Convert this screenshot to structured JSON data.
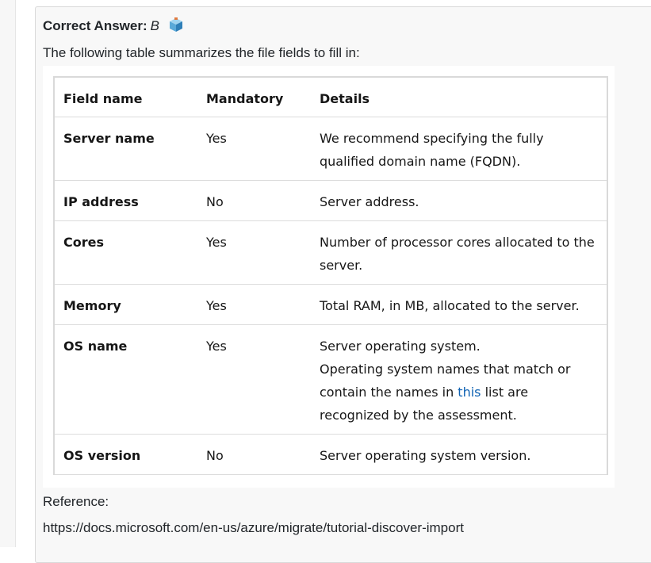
{
  "answer": {
    "label": "Correct Answer:",
    "value": "B",
    "icon": "community-vote-cube-icon"
  },
  "intro_text": "The following table summarizes the file fields to fill in:",
  "table": {
    "headers": [
      "Field name",
      "Mandatory",
      "Details"
    ],
    "rows": [
      {
        "field": "Server name",
        "mandatory": "Yes",
        "details": "We recommend specifying the fully qualified domain name (FQDN)."
      },
      {
        "field": "IP address",
        "mandatory": "No",
        "details": "Server address."
      },
      {
        "field": "Cores",
        "mandatory": "Yes",
        "details": "Number of processor cores allocated to the server."
      },
      {
        "field": "Memory",
        "mandatory": "Yes",
        "details": "Total RAM, in MB, allocated to the server."
      },
      {
        "field": "OS name",
        "mandatory": "Yes",
        "details_line1": "Server operating system.",
        "details_pre": "Operating system names that match or contain the names in ",
        "details_link": "this",
        "details_post": " list are recognized by the assessment."
      },
      {
        "field": "OS version",
        "mandatory": "No",
        "details": "Server operating system version."
      }
    ]
  },
  "reference": {
    "label": "Reference:",
    "url": "https://docs.microsoft.com/en-us/azure/migrate/tutorial-discover-import"
  },
  "colors": {
    "link": "#0f62b3",
    "cube_top": "#7fc4e8",
    "cube_side": "#3a8dc4"
  }
}
